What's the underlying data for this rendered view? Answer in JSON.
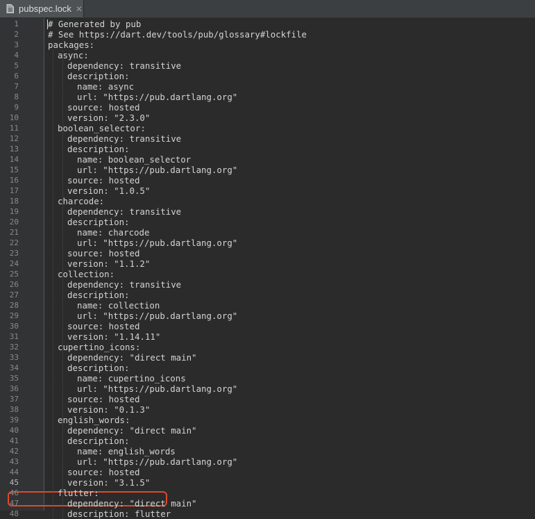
{
  "tab": {
    "label": "pubspec.lock",
    "close_glyph": "✕"
  },
  "editor": {
    "first_line": 1,
    "highlighted_line": 45,
    "lines": [
      {
        "n": "1",
        "indent": 0,
        "text": "# Generated by pub"
      },
      {
        "n": "2",
        "indent": 0,
        "text": "# See https://dart.dev/tools/pub/glossary#lockfile"
      },
      {
        "n": "3",
        "indent": 0,
        "text": "packages:"
      },
      {
        "n": "4",
        "indent": 1,
        "text": "async:"
      },
      {
        "n": "5",
        "indent": 2,
        "text": "dependency: transitive"
      },
      {
        "n": "6",
        "indent": 2,
        "text": "description:"
      },
      {
        "n": "7",
        "indent": 3,
        "text": "name: async"
      },
      {
        "n": "8",
        "indent": 3,
        "text": "url: \"https://pub.dartlang.org\""
      },
      {
        "n": "9",
        "indent": 2,
        "text": "source: hosted"
      },
      {
        "n": "10",
        "indent": 2,
        "text": "version: \"2.3.0\""
      },
      {
        "n": "11",
        "indent": 1,
        "text": "boolean_selector:"
      },
      {
        "n": "12",
        "indent": 2,
        "text": "dependency: transitive"
      },
      {
        "n": "13",
        "indent": 2,
        "text": "description:"
      },
      {
        "n": "14",
        "indent": 3,
        "text": "name: boolean_selector"
      },
      {
        "n": "15",
        "indent": 3,
        "text": "url: \"https://pub.dartlang.org\""
      },
      {
        "n": "16",
        "indent": 2,
        "text": "source: hosted"
      },
      {
        "n": "17",
        "indent": 2,
        "text": "version: \"1.0.5\""
      },
      {
        "n": "18",
        "indent": 1,
        "text": "charcode:"
      },
      {
        "n": "19",
        "indent": 2,
        "text": "dependency: transitive"
      },
      {
        "n": "20",
        "indent": 2,
        "text": "description:"
      },
      {
        "n": "21",
        "indent": 3,
        "text": "name: charcode"
      },
      {
        "n": "22",
        "indent": 3,
        "text": "url: \"https://pub.dartlang.org\""
      },
      {
        "n": "23",
        "indent": 2,
        "text": "source: hosted"
      },
      {
        "n": "24",
        "indent": 2,
        "text": "version: \"1.1.2\""
      },
      {
        "n": "25",
        "indent": 1,
        "text": "collection:"
      },
      {
        "n": "26",
        "indent": 2,
        "text": "dependency: transitive"
      },
      {
        "n": "27",
        "indent": 2,
        "text": "description:"
      },
      {
        "n": "28",
        "indent": 3,
        "text": "name: collection"
      },
      {
        "n": "29",
        "indent": 3,
        "text": "url: \"https://pub.dartlang.org\""
      },
      {
        "n": "30",
        "indent": 2,
        "text": "source: hosted"
      },
      {
        "n": "31",
        "indent": 2,
        "text": "version: \"1.14.11\""
      },
      {
        "n": "32",
        "indent": 1,
        "text": "cupertino_icons:"
      },
      {
        "n": "33",
        "indent": 2,
        "text": "dependency: \"direct main\""
      },
      {
        "n": "34",
        "indent": 2,
        "text": "description:"
      },
      {
        "n": "35",
        "indent": 3,
        "text": "name: cupertino_icons"
      },
      {
        "n": "36",
        "indent": 3,
        "text": "url: \"https://pub.dartlang.org\""
      },
      {
        "n": "37",
        "indent": 2,
        "text": "source: hosted"
      },
      {
        "n": "38",
        "indent": 2,
        "text": "version: \"0.1.3\""
      },
      {
        "n": "39",
        "indent": 1,
        "text": "english_words:"
      },
      {
        "n": "40",
        "indent": 2,
        "text": "dependency: \"direct main\""
      },
      {
        "n": "41",
        "indent": 2,
        "text": "description:"
      },
      {
        "n": "42",
        "indent": 3,
        "text": "name: english_words"
      },
      {
        "n": "43",
        "indent": 3,
        "text": "url: \"https://pub.dartlang.org\""
      },
      {
        "n": "44",
        "indent": 2,
        "text": "source: hosted"
      },
      {
        "n": "45",
        "indent": 2,
        "text": "version: \"3.1.5\""
      },
      {
        "n": "46",
        "indent": 1,
        "text": "flutter:"
      },
      {
        "n": "47",
        "indent": 2,
        "text": "dependency: \"direct main\""
      },
      {
        "n": "48",
        "indent": 2,
        "text": "description: flutter"
      }
    ]
  },
  "colors": {
    "background": "#2b2b2b",
    "gutter": "#313335",
    "text": "#d4d4d4",
    "line_number": "#8a8a8a",
    "highlight_border": "#e0492a"
  }
}
